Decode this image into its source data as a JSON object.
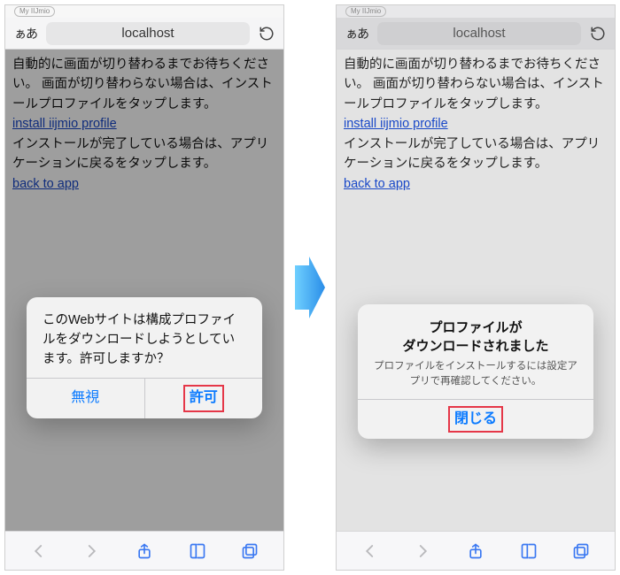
{
  "statusbar": {
    "carrier": "My IIJmio"
  },
  "addrbar": {
    "aa": "ぁあ",
    "url": "localhost"
  },
  "page": {
    "line1": "自動的に画面が切り替わるまでお待ちください。",
    "line2": "画面が切り替わらない場合は、インストールプロファイルをタップします。",
    "link_install": "install iijmio profile",
    "line3": "インストールが完了している場合は、アプリケーションに戻るをタップします。",
    "link_back": "back to app"
  },
  "alert_prompt": {
    "message": "このWebサイトは構成プロファイルをダウンロードしようとしています。許可しますか？",
    "ignore": "無視",
    "allow": "許可"
  },
  "alert_done": {
    "title_l1": "プロファイルが",
    "title_l2": "ダウンロードされました",
    "sub": "プロファイルをインストールするには設定アプリで再確認してください。",
    "close": "閉じる"
  }
}
